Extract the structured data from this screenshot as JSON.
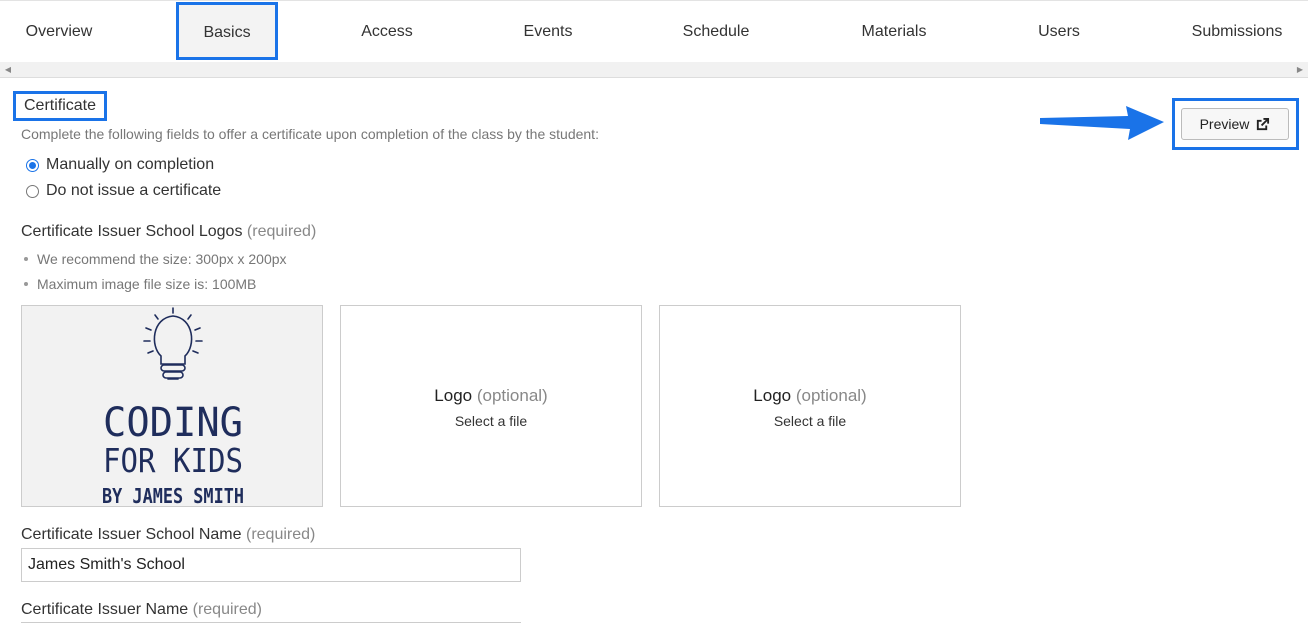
{
  "tabs": [
    {
      "label": "Overview"
    },
    {
      "label": "Basics"
    },
    {
      "label": "Access"
    },
    {
      "label": "Events"
    },
    {
      "label": "Schedule"
    },
    {
      "label": "Materials"
    },
    {
      "label": "Users"
    },
    {
      "label": "Submissions"
    }
  ],
  "active_tab": "Basics",
  "certificate": {
    "title": "Certificate",
    "description": "Complete the following fields to offer a certificate upon completion of the class by the student:",
    "options": [
      {
        "label": "Manually on completion",
        "checked": true
      },
      {
        "label": "Do not issue a certificate",
        "checked": false
      }
    ],
    "preview_label": "Preview"
  },
  "logos": {
    "label": "Certificate Issuer School Logos",
    "required": "(required)",
    "hints": [
      "We recommend the size: 300px x 200px",
      "Maximum image file size is: 100MB"
    ],
    "uploaded_logo": {
      "line1": "CODING",
      "line2": "FOR KIDS",
      "line3": "BY JAMES SMITH",
      "color": "#1f2d5c"
    },
    "slots": [
      {
        "label": "Logo",
        "optional": "(optional)",
        "action": "Select a file"
      },
      {
        "label": "Logo",
        "optional": "(optional)",
        "action": "Select a file"
      }
    ]
  },
  "school_name": {
    "label": "Certificate Issuer School Name",
    "required": "(required)",
    "value": "James Smith's School"
  },
  "issuer_name": {
    "label": "Certificate Issuer Name",
    "required": "(required)"
  },
  "colors": {
    "highlight": "#1a73e8",
    "annotation_arrow": "#1a73e8"
  }
}
